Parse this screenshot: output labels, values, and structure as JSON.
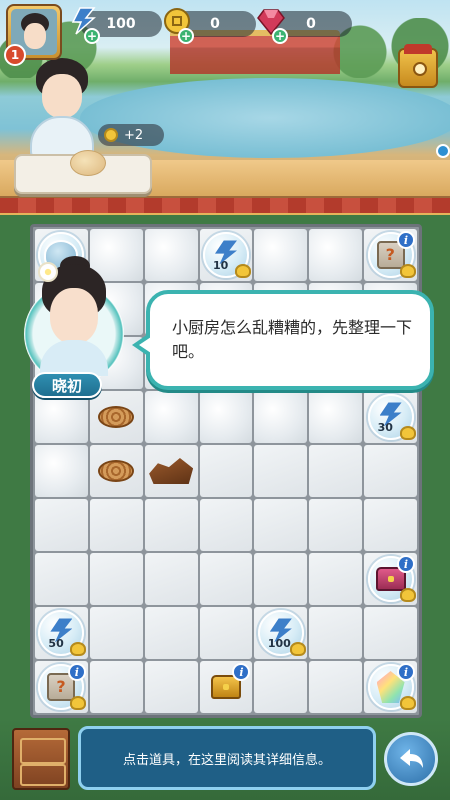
{
  "player": {
    "level": "1"
  },
  "resources": {
    "energy": "100",
    "coins": "0",
    "gems": "0"
  },
  "order": {
    "reward": "+2"
  },
  "dialog": {
    "speaker": "晓初",
    "text": "小厨房怎么乱糟糟的，先整理一下吧。"
  },
  "board": {
    "labels": {
      "energy_10": "10",
      "energy_30": "30",
      "energy_50": "50",
      "energy_100": "100"
    },
    "info_mark": "i"
  },
  "bottom": {
    "hint": "点击道具，在这里阅读其详细信息。",
    "return_icon": "return-arrow-icon"
  },
  "colors": {
    "dialog_border": "#3bb3b0",
    "energy_bolt": "#3d7fc9",
    "info_badge": "#2f6fc7",
    "hint_panel": "#1f5f86"
  }
}
